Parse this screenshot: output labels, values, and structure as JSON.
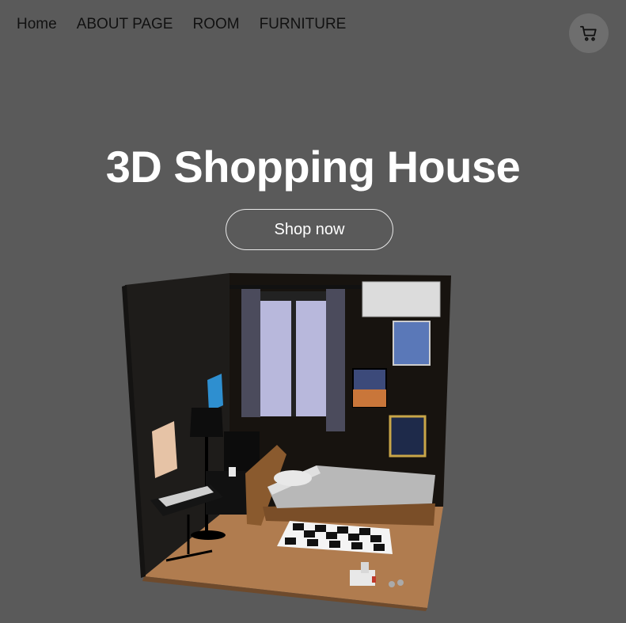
{
  "nav": {
    "items": [
      {
        "label": "Home"
      },
      {
        "label": "ABOUT PAGE"
      },
      {
        "label": "ROOM"
      },
      {
        "label": "FURNITURE"
      }
    ]
  },
  "cart": {
    "icon": "shopping-cart-icon"
  },
  "hero": {
    "title": "3D Shopping House",
    "button_label": "Shop now"
  },
  "scene": {
    "description_icon": "3d-bedroom-model"
  },
  "colors": {
    "background": "#5a5a5a",
    "title": "#ffffff",
    "nav_text": "#111111",
    "cart_bg": "#6e6e6e"
  }
}
